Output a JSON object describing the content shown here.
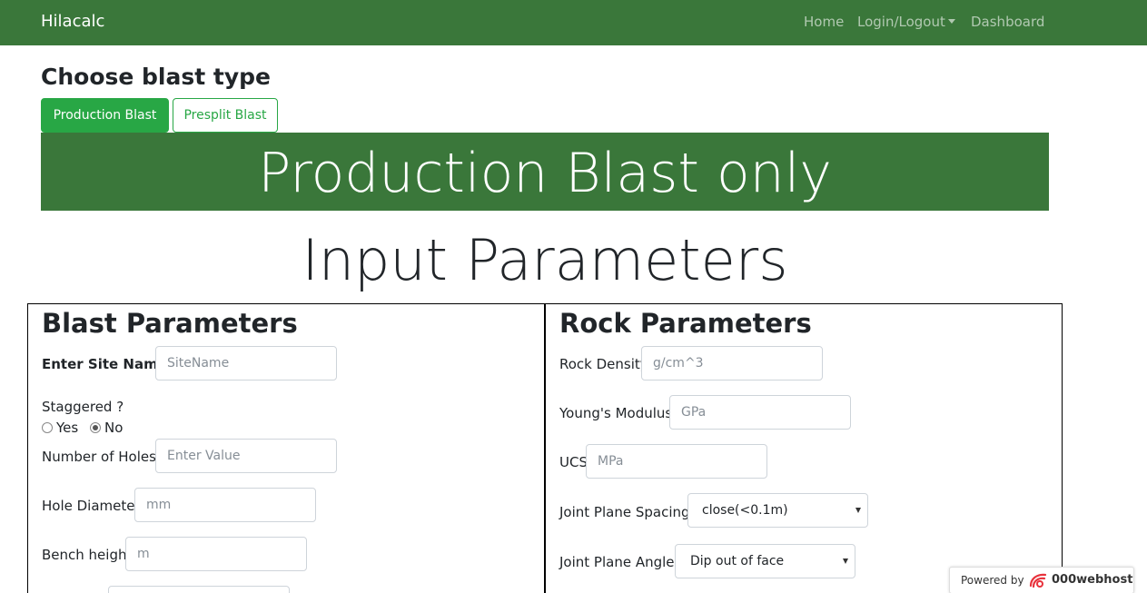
{
  "navbar": {
    "brand": "Hilacalc",
    "home": "Home",
    "login_logout": "Login/Logout",
    "dashboard": "Dashboard"
  },
  "blast_type": {
    "title": "Choose blast type",
    "production_button": "Production Blast",
    "presplit_button": "Presplit Blast"
  },
  "banner": "Production Blast only",
  "input_title": "Input Parameters",
  "blast_parameters": {
    "title": "Blast Parameters",
    "site_name_label": "Enter Site Name",
    "site_name_placeholder": "SiteName",
    "staggered_label": "Staggered ?",
    "yes_label": "Yes",
    "no_label": "No",
    "staggered_selected": "No",
    "holes_label": "Number of Holes",
    "holes_placeholder": "Enter Value",
    "diameter_label": "Hole Diameter",
    "diameter_placeholder": "mm",
    "bench_label": "Bench height",
    "bench_placeholder": "m"
  },
  "rock_parameters": {
    "title": "Rock Parameters",
    "density_label": "Rock Density",
    "density_placeholder": "g/cm^3",
    "youngs_label": "Young's Modulus",
    "youngs_placeholder": "GPa",
    "ucs_label": "UCS",
    "ucs_placeholder": "MPa",
    "joint_spacing_label": "Joint Plane Spacing",
    "joint_spacing_value": "close(<0.1m)",
    "joint_angle_label": "Joint Plane Angle",
    "joint_angle_value": "Dip out of face"
  },
  "powered_by": {
    "text": "Powered by",
    "brand": "000webhost"
  },
  "colors": {
    "navbar": "#3a773a",
    "banner": "#3a773a",
    "button_success": "#28a745"
  }
}
